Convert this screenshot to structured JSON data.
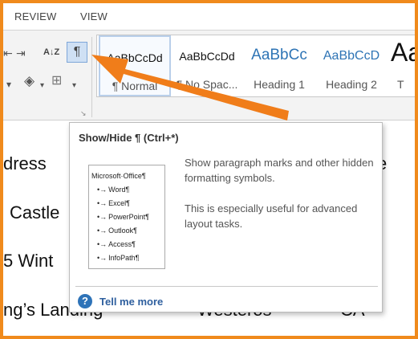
{
  "ribbon_tabs": [
    {
      "label": "REVIEW"
    },
    {
      "label": "VIEW"
    }
  ],
  "ribbon": {
    "sort_glyph": "A↓Z",
    "show_hide_glyph": "¶",
    "launcher_glyph": "↘",
    "styles": [
      {
        "sample": "AaBbCcDd",
        "name": "¶ Normal",
        "selected": true
      },
      {
        "sample": "AaBbCcDd",
        "name": "¶ No Spac..."
      },
      {
        "sample": "AaBbCc",
        "name": "Heading 1"
      },
      {
        "sample": "AaBbCcD",
        "name": "Heading 2"
      },
      {
        "sample": "Aa",
        "name": "T"
      }
    ]
  },
  "document": {
    "lines": [
      {
        "left": "dress",
        "right": "e"
      },
      {
        "left": "Castle",
        "right": ""
      },
      {
        "left": "5 Wint",
        "right": ""
      },
      {
        "left": "ng’s Landing",
        "mid": "Westeros",
        "right": "CA"
      }
    ]
  },
  "tooltip": {
    "title": "Show/Hide ¶ (Ctrl+*)",
    "preview_header": "Microsoft·Office¶",
    "preview_items": [
      "Word¶",
      "Excel¶",
      "PowerPoint¶",
      "Outlook¶",
      "Access¶",
      "InfoPath¶"
    ],
    "description_1": "Show paragraph marks and other hidden formatting symbols.",
    "description_2": "This is especially useful for advanced layout tasks.",
    "help_link": "Tell me more",
    "help_glyph": "?"
  },
  "colors": {
    "frame": "#f08a1c",
    "arrow": "#f07d1a",
    "heading_style": "#2e74b5",
    "help_link": "#2e5f9e"
  }
}
